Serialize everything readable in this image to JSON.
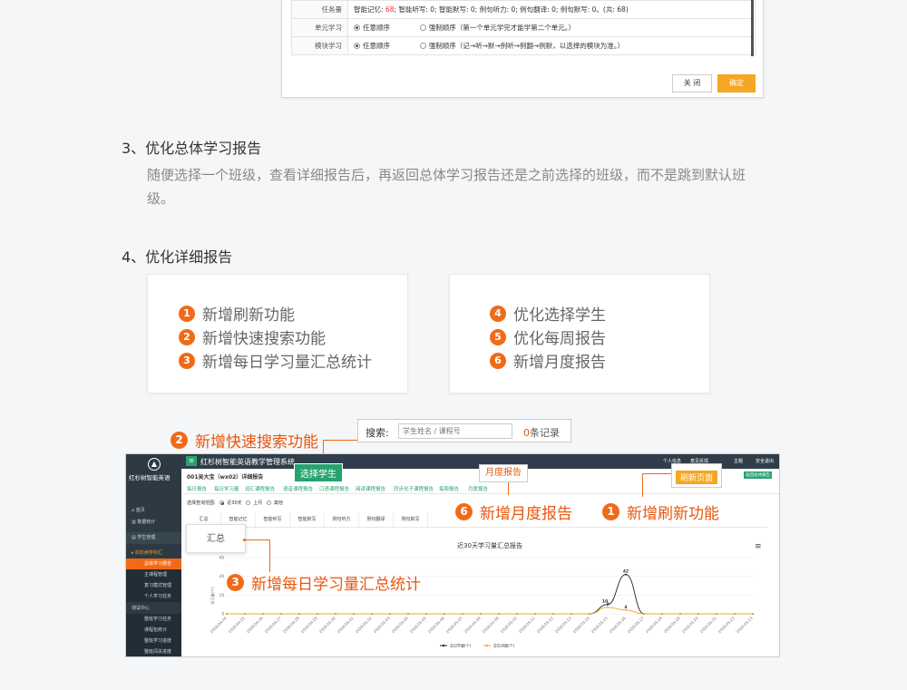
{
  "dialog": {
    "rows": [
      {
        "label": "任务量",
        "text": "智能记忆: ",
        "red1": "68",
        "rest": "; 智能听写: 0; 智能默写: 0; 例句听力: 0; 例句翻译: 0; 例句默写: 0。(共: 68)"
      },
      {
        "label": "单元学习",
        "opt1": "任意顺序",
        "opt2": "强制顺序（第一个单元学完才能学第二个单元。）"
      },
      {
        "label": "模块学习",
        "opt1": "任意顺序",
        "opt2": "强制顺序（记→听→默→例听→例翻→例默，以选择的模块为准。）"
      }
    ],
    "close_label": "关 闭",
    "ok_label": "确定"
  },
  "section3": {
    "title": "3、优化总体学习报告",
    "body": "随便选择一个班级，查看详细报告后，再返回总体学习报告还是之前选择的班级，而不是跳到默认班级。"
  },
  "section4": {
    "title": "4、优化详细报告",
    "features_left": [
      {
        "num": "1",
        "text": "新增刷新功能"
      },
      {
        "num": "2",
        "text": "新增快速搜索功能"
      },
      {
        "num": "3",
        "text": "新增每日学习量汇总统计"
      }
    ],
    "features_right": [
      {
        "num": "4",
        "text": "优化选择学生"
      },
      {
        "num": "5",
        "text": "优化每周报告"
      },
      {
        "num": "6",
        "text": "新增月度报告"
      }
    ]
  },
  "callouts": {
    "search": {
      "num": "2",
      "text": "新增快速搜索功能"
    },
    "monthly": {
      "num": "6",
      "text": "新增月度报告"
    },
    "refresh": {
      "num": "1",
      "text": "新增刷新功能"
    },
    "daily": {
      "num": "3",
      "text": "新增每日学习量汇总统计"
    },
    "select_student": "选择学生",
    "month_report": "月度报告",
    "refresh_page": "刷新页面",
    "summary": "汇总"
  },
  "search_box": {
    "label": "搜索:",
    "placeholder": "学生姓名 / 课程号",
    "count": "0",
    "count_suffix": "条记录"
  },
  "app": {
    "title": "红杉树智能英语教学管理系统",
    "logo_text": "红杉树智能英语",
    "top_right": [
      "个人信息",
      "意见反馈",
      "主题",
      "安全退出"
    ],
    "student": "001吴大宝（wx02）详细报告",
    "return_btn": "返回总体报告",
    "tabs": [
      "每日报告",
      "每日学习量",
      "词汇课程报告",
      "语音课程报告",
      "口语课程报告",
      "阅读课程报告",
      "同步化子课程报告",
      "每周报告",
      "月度报告"
    ],
    "range_label": "选择查询范围:",
    "range_opts": [
      "近30天",
      "上月",
      "其他"
    ],
    "stat_cols": [
      "汇总",
      "智能记忆",
      "智能听写",
      "智能默写",
      "例句听力",
      "例句翻译",
      "例句默写"
    ],
    "sidebar": [
      {
        "label": "首页"
      },
      {
        "label": "数据统计"
      },
      {
        "label": "学生管理"
      },
      {
        "label": "红杉树学科汇"
      },
      {
        "label": "总体学习报告"
      },
      {
        "label": "主课程管理"
      },
      {
        "label": "复习模式管理"
      },
      {
        "label": "个人学习任务"
      },
      {
        "label": "测试中心"
      },
      {
        "label": "整班学习任务"
      },
      {
        "label": "课程包统计"
      },
      {
        "label": "整班学习进度"
      },
      {
        "label": "整班闯关进度"
      }
    ]
  },
  "chart_data": {
    "type": "line",
    "title": "近30天学习量汇总报告",
    "ylabel": "学习量(个)",
    "ylim": [
      0,
      60
    ],
    "yticks": [
      0,
      20,
      40,
      60
    ],
    "x": [
      "2018-04-24",
      "2018-04-25",
      "2018-04-26",
      "2018-04-27",
      "2018-04-28",
      "2018-04-29",
      "2018-04-30",
      "2018-05-01",
      "2018-05-02",
      "2018-05-03",
      "2018-05-04",
      "2018-05-05",
      "2018-05-06",
      "2018-05-07",
      "2018-05-08",
      "2018-05-09",
      "2018-05-10",
      "2018-05-11",
      "2018-05-12",
      "2018-05-13",
      "2018-05-14",
      "2018-05-15",
      "2018-05-16",
      "2018-05-17",
      "2018-05-18",
      "2018-05-19",
      "2018-05-20",
      "2018-05-21",
      "2018-05-22",
      "2018-05-23"
    ],
    "series": [
      {
        "name": "总记学量(个)",
        "color": "#222222",
        "values": [
          0,
          0,
          0,
          0,
          0,
          0,
          0,
          0,
          0,
          0,
          0,
          0,
          0,
          0,
          0,
          0,
          0,
          0,
          0,
          0,
          0,
          10,
          42,
          0,
          0,
          0,
          0,
          0,
          0,
          0
        ]
      },
      {
        "name": "总生词量(个)",
        "color": "#f5a623",
        "values": [
          0,
          0,
          0,
          0,
          0,
          0,
          0,
          0,
          0,
          0,
          0,
          0,
          0,
          0,
          0,
          0,
          0,
          0,
          0,
          0,
          0,
          7,
          4,
          0,
          0,
          0,
          0,
          0,
          0,
          0
        ]
      }
    ]
  },
  "colors": {
    "accent": "#f06b19",
    "green": "#27a36f",
    "dark": "#2f3e4a"
  }
}
